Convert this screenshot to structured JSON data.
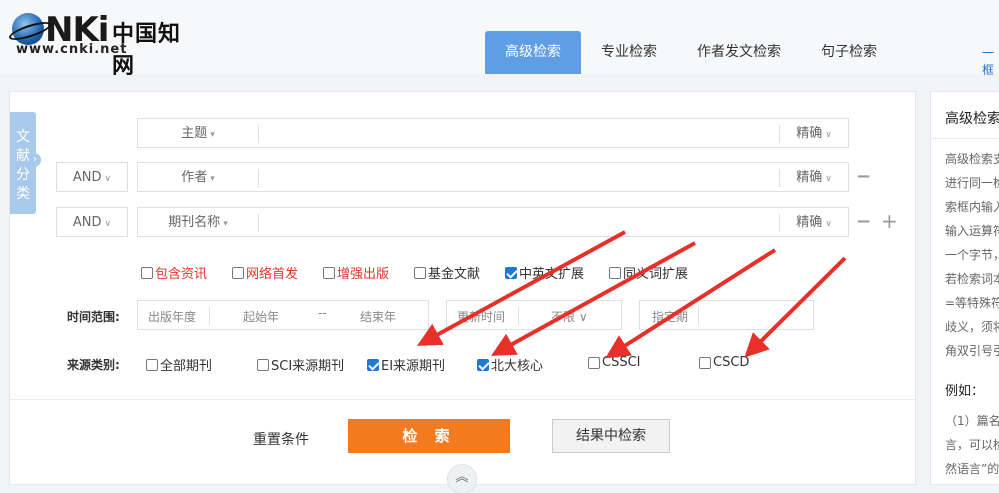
{
  "logo": {
    "brand": "CNKI",
    "chinese": "中国知网",
    "url": "www.cnki.net"
  },
  "tabs": [
    "高级检索",
    "专业检索",
    "作者发文检索",
    "句子检索"
  ],
  "tab_more": "一框",
  "side_tab": {
    "lines": [
      "文",
      "献",
      "分",
      "类"
    ]
  },
  "rows": [
    {
      "bool": "",
      "field": "主题",
      "match": "精确"
    },
    {
      "bool": "AND",
      "field": "作者",
      "match": "精确"
    },
    {
      "bool": "AND",
      "field": "期刊名称",
      "match": "精确"
    }
  ],
  "options": [
    {
      "label": "包含资讯",
      "checked": false,
      "red": true
    },
    {
      "label": "网络首发",
      "checked": false,
      "red": true
    },
    {
      "label": "增强出版",
      "checked": false,
      "red": true
    },
    {
      "label": "基金文献",
      "checked": false,
      "red": false
    },
    {
      "label": "中英文扩展",
      "checked": true,
      "red": false
    },
    {
      "label": "同义词扩展",
      "checked": false,
      "red": false
    }
  ],
  "time": {
    "label": "时间范围:",
    "pub_year": "出版年度",
    "start": "起始年",
    "dash": "--",
    "end": "结束年",
    "update_time": "更新时间",
    "unlimited": "不限",
    "specified": "指定期"
  },
  "source": {
    "label": "来源类别:",
    "items": [
      {
        "label": "全部期刊",
        "checked": false
      },
      {
        "label": "SCI来源期刊",
        "checked": false
      },
      {
        "label": "EI来源期刊",
        "checked": true
      },
      {
        "label": "北大核心",
        "checked": true
      },
      {
        "label": "CSSCI",
        "checked": false
      },
      {
        "label": "CSCD",
        "checked": false
      }
    ]
  },
  "actions": {
    "reset": "重置条件",
    "search": "检 索",
    "within": "结果中检索"
  },
  "help": {
    "title": "高级检索",
    "lines": [
      "高级检索支",
      "进行同一检",
      "索框内输入",
      "输入运算符",
      "一个字节，",
      "若检索词本",
      "=等特殊符",
      "歧义，须将",
      "角双引号引"
    ],
    "example": "例如：",
    "ex_lines": [
      "（1）篇名",
      "言，可以检",
      "然语言”的"
    ]
  },
  "colors": {
    "accent": "#5f9ee3",
    "search": "#f47a20",
    "arrow": "#e8302a"
  }
}
